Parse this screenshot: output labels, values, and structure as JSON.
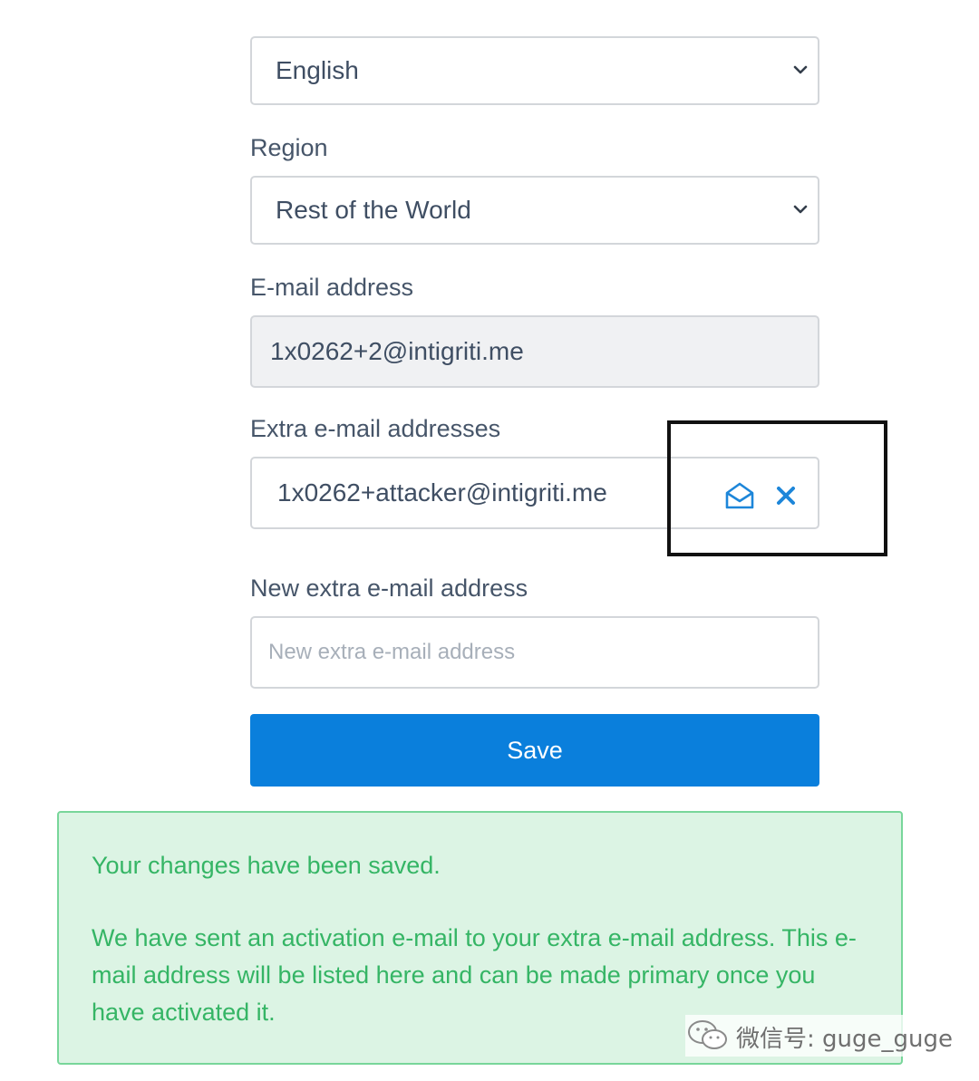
{
  "language_select": {
    "value": "English"
  },
  "region": {
    "label": "Region",
    "value": "Rest of the World"
  },
  "email": {
    "label": "E-mail address",
    "value": "1x0262+2@intigriti.me"
  },
  "extra_emails": {
    "label": "Extra e-mail addresses",
    "items": [
      {
        "address": "1x0262+attacker@intigriti.me",
        "icons": [
          "envelope-open-icon",
          "close-icon"
        ]
      }
    ]
  },
  "new_extra_email": {
    "label": "New extra e-mail address",
    "placeholder": "New extra e-mail address"
  },
  "save_button": {
    "label": "Save"
  },
  "alert": {
    "line1": "Your changes have been saved.",
    "line2": "We have sent an activation e-mail to your extra e-mail address. This e-mail address will be listed here and can be made primary once you have activated it."
  },
  "watermark": {
    "text": "微信号: guge_guge"
  },
  "colors": {
    "primary_button": "#0a7fdc",
    "icon_blue": "#1d86d9",
    "success_text": "#35b565",
    "success_bg": "#dcf4e4",
    "success_border": "#78d69a"
  }
}
